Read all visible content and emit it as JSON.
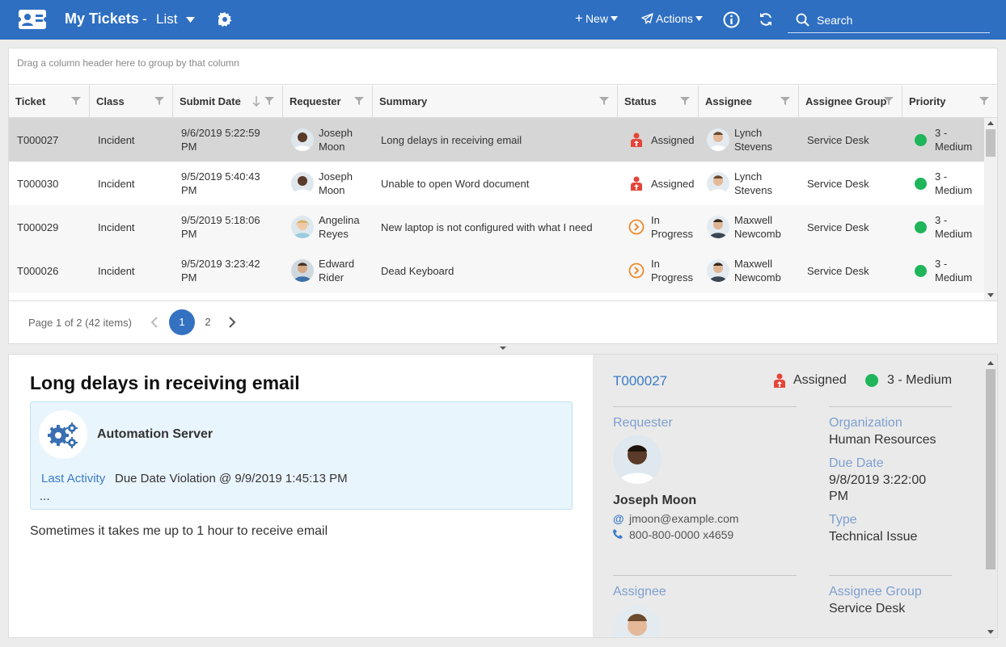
{
  "header": {
    "title": "My Tickets",
    "title_separator": "-",
    "view_label": "List",
    "new_label": "New",
    "actions_label": "Actions",
    "search_placeholder": "Search"
  },
  "colors": {
    "topbar": "#2e6fc2",
    "accent": "#3b7bc8",
    "selected_row": "#d6d6d6",
    "status_assigned": "#e6453a",
    "status_in_progress": "#ef8a2b",
    "priority_medium": "#1fb55a"
  },
  "grid": {
    "group_hint": "Drag a column header here to group by that column",
    "columns": [
      "Ticket",
      "Class",
      "Submit Date",
      "Requester",
      "Summary",
      "Status",
      "Assignee",
      "Assignee Group",
      "Priority"
    ],
    "sorted_column": "Submit Date",
    "sort_direction": "descending",
    "rows": [
      {
        "ticket": "T000027",
        "class": "Incident",
        "submit_date": "9/6/2019 5:22:59 PM",
        "requester": "Joseph Moon",
        "summary": "Long delays in receiving email",
        "status": "Assigned",
        "status_icon": "assigned-person-icon",
        "assignee": "Lynch Stevens",
        "assignee_group": "Service Desk",
        "priority": "3 - Medium",
        "selected": true
      },
      {
        "ticket": "T000030",
        "class": "Incident",
        "submit_date": "9/5/2019 5:40:43 PM",
        "requester": "Joseph Moon",
        "summary": "Unable to open Word document",
        "status": "Assigned",
        "status_icon": "assigned-person-icon",
        "assignee": "Lynch Stevens",
        "assignee_group": "Service Desk",
        "priority": "3 - Medium",
        "selected": false
      },
      {
        "ticket": "T000029",
        "class": "Incident",
        "submit_date": "9/5/2019 5:18:06 PM",
        "requester": "Angelina Reyes",
        "summary": "New laptop is not configured with what I need",
        "status": "In Progress",
        "status_icon": "in-progress-icon",
        "assignee": "Maxwell Newcomb",
        "assignee_group": "Service Desk",
        "priority": "3 - Medium",
        "selected": false
      },
      {
        "ticket": "T000026",
        "class": "Incident",
        "submit_date": "9/5/2019 3:23:42 PM",
        "requester": "Edward Rider",
        "summary": "Dead Keyboard",
        "status": "In Progress",
        "status_icon": "in-progress-icon",
        "assignee": "Maxwell Newcomb",
        "assignee_group": "Service Desk",
        "priority": "3 - Medium",
        "selected": false
      }
    ]
  },
  "pager": {
    "info": "Page 1 of 2 (42 items)",
    "pages": [
      "1",
      "2"
    ],
    "current": "1"
  },
  "detail": {
    "title": "Long delays in receiving email",
    "activity": {
      "name": "Automation Server",
      "last_activity_label": "Last Activity",
      "last_activity_text": "Due Date Violation @ 9/9/2019 1:45:13 PM",
      "more": "..."
    },
    "description": "Sometimes it takes me up to 1 hour to receive email",
    "ticket_id": "T000027",
    "status": "Assigned",
    "priority": "3 - Medium",
    "requester_label": "Requester",
    "requester_name": "Joseph Moon",
    "requester_email_icon": "@",
    "requester_email": "jmoon@example.com",
    "requester_phone": "800-800-0000 x4659",
    "organization_label": "Organization",
    "organization": "Human Resources",
    "due_date_label": "Due Date",
    "due_date": "9/8/2019 3:22:00 PM",
    "type_label": "Type",
    "type": "Technical Issue",
    "assignee_label": "Assignee",
    "assignee_group_label": "Assignee Group",
    "assignee_group": "Service Desk"
  }
}
